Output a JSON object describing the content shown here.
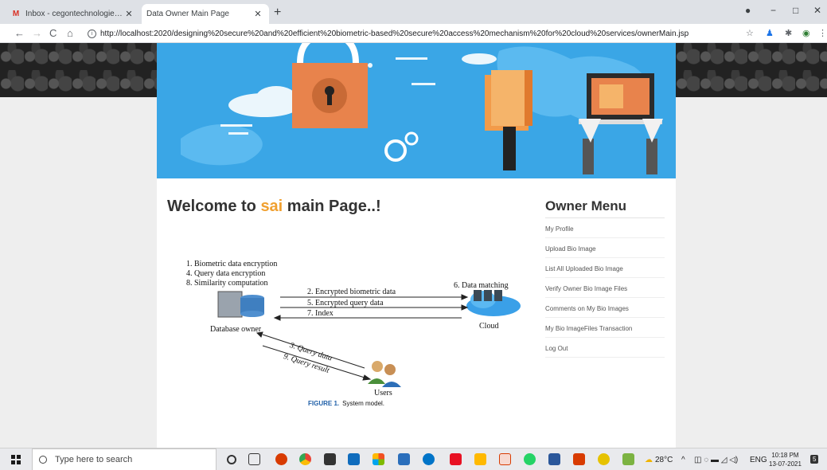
{
  "browser": {
    "tabs": [
      {
        "title": "Inbox - cegontechnologies@gm...",
        "icon": "gmail-icon",
        "active": false
      },
      {
        "title": "Data Owner Main Page",
        "icon": "page-icon",
        "active": true
      }
    ],
    "new_tab_label": "+",
    "window_controls": {
      "minimize": "−",
      "maximize": "□",
      "close": "✕"
    },
    "nav": {
      "back": "←",
      "forward": "→",
      "reload": "C",
      "home": "⌂"
    },
    "url": "http://localhost:2020/designing%20secure%20and%20efficient%20biometric-based%20secure%20access%20mechanism%20for%20cloud%20services/ownerMain.jsp",
    "bookmark_icon": "☆"
  },
  "page": {
    "welcome_prefix": "Welcome to ",
    "username": "sai",
    "welcome_suffix": " main Page..!",
    "figure": {
      "steps": [
        "1. Biometric data encryption",
        "4. Query data encryption",
        "8. Similarity computation"
      ],
      "arrows": [
        "2. Encrypted biometric data",
        "5. Encrypted query data",
        "7. Index"
      ],
      "diag_arrows": [
        "3. Query data",
        "9. Query result"
      ],
      "nodes": {
        "owner": "Database owner",
        "cloud": "Cloud",
        "users": "Users",
        "matching": "6. Data matching"
      },
      "caption_number": "FIGURE 1.",
      "caption_text": "System model."
    },
    "menu": {
      "title": "Owner Menu",
      "items": [
        "My Profile",
        "Upload Bio Image",
        "List All Uploaded Bio Image",
        "Verify Owner Bio Image Files",
        "Comments on My Bio Images",
        "My Bio ImageFiles Transaction",
        "Log Out"
      ]
    },
    "colors": {
      "username": "#f0a030",
      "banner": "#3aa6e6",
      "caption_accent": "#1f5fa8"
    }
  },
  "taskbar": {
    "search_placeholder": "Type here to search",
    "weather": "28°C",
    "language": "ENG",
    "time": "10:18 PM",
    "date": "13-07-2021",
    "notification_count": "5"
  }
}
